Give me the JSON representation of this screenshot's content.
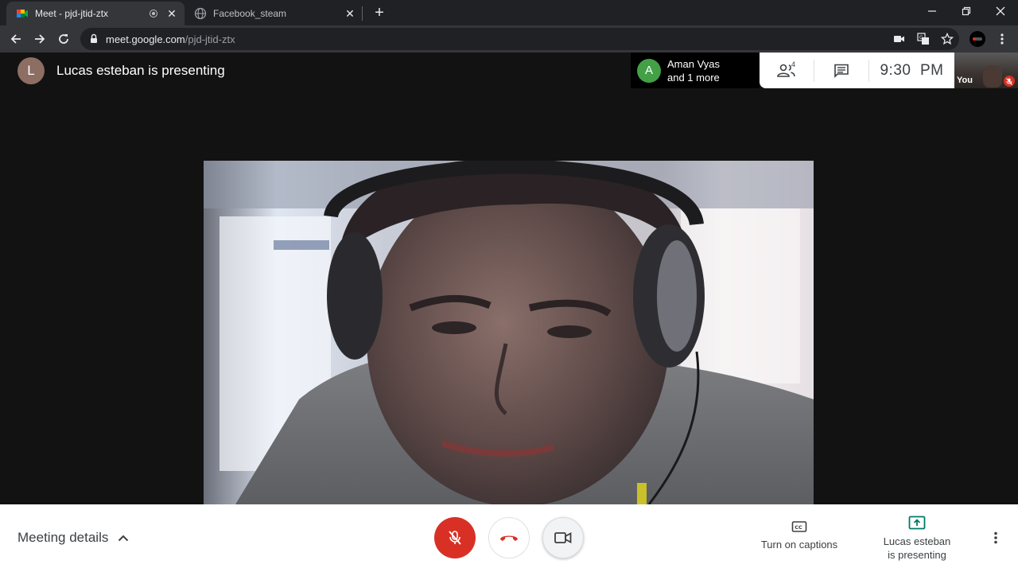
{
  "browser": {
    "tabs": [
      {
        "title": "Meet - pjd-jtid-ztx",
        "active": true
      },
      {
        "title": "Facebook_steam",
        "active": false
      }
    ],
    "url_host": "meet.google.com",
    "url_path": "/pjd-jtid-ztx"
  },
  "meet": {
    "presenter_initial": "L",
    "presenter_text": "Lucas esteban is presenting",
    "participants": {
      "avatar_initial": "A",
      "name": "Aman Vyas",
      "more": "and 1 more",
      "count": "4"
    },
    "clock": "9:30  PM",
    "self_label": "You"
  },
  "controls": {
    "meeting_details": "Meeting details",
    "captions": "Turn on captions",
    "presenting_line1": "Lucas esteban",
    "presenting_line2": "is presenting"
  },
  "colors": {
    "mic_off": "#d93025",
    "hangup": "#d93025",
    "present_accent": "#00796b",
    "participant_avatar": "#43a047",
    "presenter_avatar": "#8d6e63"
  }
}
